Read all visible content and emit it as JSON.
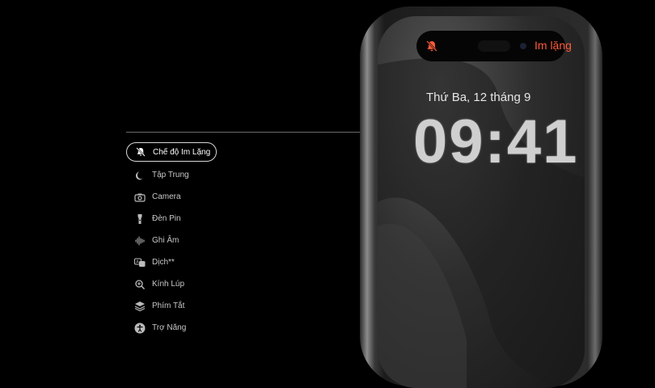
{
  "phone": {
    "island_status": "Im lặng",
    "date": "Thứ Ba, 12 tháng 9",
    "time": "09:41"
  },
  "menu": {
    "items": [
      {
        "label": "Chế độ Im Lặng",
        "icon": "bell-slash-icon",
        "active": true
      },
      {
        "label": "Tập Trung",
        "icon": "moon-icon"
      },
      {
        "label": "Camera",
        "icon": "camera-icon"
      },
      {
        "label": "Đèn Pin",
        "icon": "flashlight-icon"
      },
      {
        "label": "Ghi Âm",
        "icon": "waveform-icon"
      },
      {
        "label": "Dịch**",
        "icon": "translate-icon"
      },
      {
        "label": "Kính Lúp",
        "icon": "magnifier-icon"
      },
      {
        "label": "Phím Tắt",
        "icon": "shortcuts-icon"
      },
      {
        "label": "Trợ Năng",
        "icon": "accessibility-icon"
      }
    ]
  },
  "colors": {
    "silent_accent": "#ff5b3a",
    "background": "#000000"
  }
}
